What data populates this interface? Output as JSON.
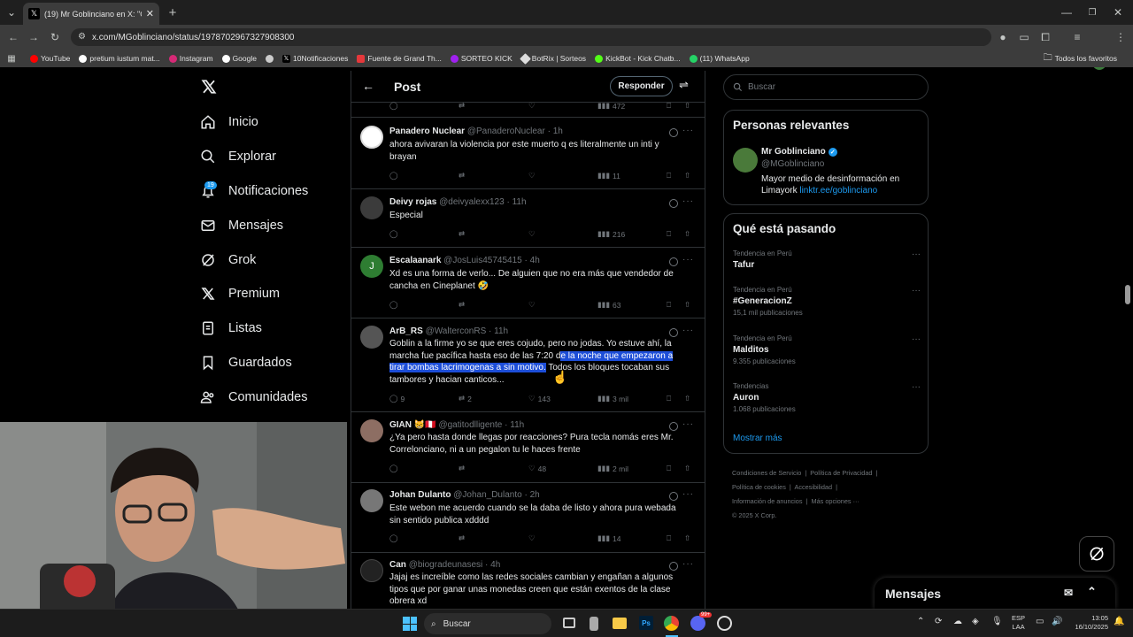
{
  "browser": {
    "tab_title": "(19) Mr Goblinciano en X: \"Ose",
    "url": "x.com/MGoblinciano/status/1978702967327908300",
    "bookmarks": [
      "YouTube",
      "pretium iustum mat...",
      "Instagram",
      "Google",
      "",
      "10Notificaciones",
      "Fuente de Grand Th...",
      "SORTEO KICK",
      "BotRix | Sorteos",
      "KickBot - Kick Chatb...",
      "(11) WhatsApp"
    ],
    "all_bookmarks": "Todos los favoritos"
  },
  "nav": {
    "items": [
      "Inicio",
      "Explorar",
      "Notificaciones",
      "Mensajes",
      "Grok",
      "Premium",
      "Listas",
      "Guardados",
      "Comunidades"
    ],
    "notif_badge": "19"
  },
  "post_header": {
    "title": "Post",
    "reply_button": "Responder"
  },
  "top_stub": {
    "views": "472"
  },
  "tweets": [
    {
      "name": "Panadero Nuclear",
      "handle": "@PanaderoNuclear",
      "time": "1h",
      "text": "ahora avivaran la violencia por este muerto q es literalmente un inti y brayan",
      "replies": "",
      "retweets": "",
      "likes": "",
      "views": "11"
    },
    {
      "name": "Deivy rojas",
      "handle": "@deivyalexx123",
      "time": "11h",
      "text": "Especial",
      "replies": "",
      "retweets": "",
      "likes": "",
      "views": "216"
    },
    {
      "name": "Escalaanark",
      "handle": "@JosLuis45745415",
      "time": "4h",
      "text": "Xd es una forma de verlo... De alguien que no era más que vendedor de cancha en Cineplanet 🤣",
      "replies": "",
      "retweets": "",
      "likes": "",
      "views": "63"
    },
    {
      "name": "ArB_RS",
      "handle": "@WalterconRS",
      "time": "11h",
      "text_before": "Goblin a la firme yo se que eres cojudo, pero no jodas. Yo estuve ahí, la marcha fue pacífica hasta eso de las 7:20 d",
      "text_highlight": "e la noche que empezaron a tirar bombas lacrimogenas a sin motivo.",
      "text_after": " Todos los bloques tocaban sus tambores y hacian canticos...",
      "replies": "9",
      "retweets": "2",
      "likes": "143",
      "views": "3 mil"
    },
    {
      "name": "GIAN 😸🇵🇪",
      "handle": "@gatitodlligente",
      "time": "11h",
      "text": "¿Ya pero hasta donde llegas por reacciones? Pura tecla nomás eres Mr. Correlonciano, ni a un pegalon tu le haces frente",
      "replies": "",
      "retweets": "",
      "likes": "48",
      "views": "2 mil"
    },
    {
      "name": "Johan Dulanto",
      "handle": "@Johan_Dulanto",
      "time": "2h",
      "text": "Este webon me acuerdo cuando se la daba de listo y ahora pura webada sin sentido publica xdddd",
      "replies": "",
      "retweets": "",
      "likes": "",
      "views": "14"
    },
    {
      "name": "Can",
      "handle": "@biogradeunasesi",
      "time": "4h",
      "text": "Jajaj es increíble como las redes sociales cambian y engañan a algunos tipos que por ganar unas monedas creen que están exentos de la clase obrera xd",
      "replies": "",
      "retweets": "",
      "likes": "",
      "views": ""
    }
  ],
  "right": {
    "search_placeholder": "Buscar",
    "relevant_title": "Personas relevantes",
    "profile": {
      "name": "Mr Goblinciano",
      "handle": "@MGoblinciano",
      "bio": "Mayor medio de desinformación en Limayork ",
      "link": "linktr.ee/goblinciano"
    },
    "trends_title": "Qué está pasando",
    "trends": [
      {
        "category": "Tendencia en Perú",
        "name": "Tafur",
        "count": ""
      },
      {
        "category": "Tendencia en Perú",
        "name": "#GeneracionZ",
        "count": "15,1 mil publicaciones"
      },
      {
        "category": "Tendencia en Perú",
        "name": "Malditos",
        "count": "9.355 publicaciones"
      },
      {
        "category": "Tendencias",
        "name": "Auron",
        "count": "1.068 publicaciones"
      }
    ],
    "show_more": "Mostrar más",
    "footer": [
      "Condiciones de Servicio",
      "Política de Privacidad",
      "Política de cookies",
      "Accesibilidad",
      "Información de anuncios",
      "Más opciones ···",
      "© 2025 X Corp."
    ]
  },
  "messages_bar": "Mensajes",
  "taskbar": {
    "search": "Buscar",
    "lang1": "ESP",
    "lang2": "LAA",
    "time": "13:05",
    "date": "16/10/2025",
    "discord_badge": "99+"
  },
  "colors": {
    "accent": "#1d9bf0",
    "highlight": "#1d4ed8",
    "bg": "#000000",
    "border": "#2f3336"
  }
}
